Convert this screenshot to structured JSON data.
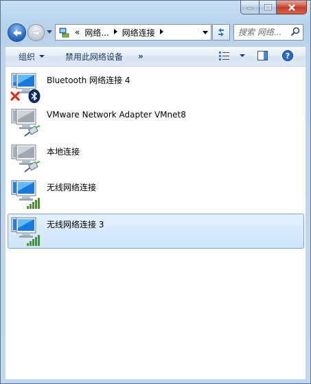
{
  "window": {
    "caption_buttons": [
      "minimize",
      "maximize",
      "close"
    ]
  },
  "nav": {
    "address_segments": [
      "«",
      "网络...",
      "网络连接"
    ],
    "search_placeholder": "搜索 网络..."
  },
  "toolbar": {
    "organize_label": "组织",
    "disable_label": "禁用此网络设备",
    "more_label": "»"
  },
  "connections": [
    {
      "name": "Bluetooth 网络连接 4",
      "icon": "computer-icon",
      "badge": "bluetooth-disconnected-icon",
      "selected": false
    },
    {
      "name": "VMware Network Adapter VMnet8",
      "icon": "computer-icon-gray",
      "badge": "ethernet-cable-icon",
      "selected": false
    },
    {
      "name": "本地连接",
      "icon": "computer-icon-gray",
      "badge": "ethernet-cable-icon",
      "selected": false
    },
    {
      "name": "无线网络连接",
      "icon": "computer-icon",
      "badge": "signal-bars-icon",
      "selected": false
    },
    {
      "name": "无线网络连接 3",
      "icon": "computer-icon",
      "badge": "signal-bars-icon",
      "selected": true
    }
  ],
  "colors": {
    "accent": "#1e395b",
    "selection_border": "#7da2ce",
    "selection_fill": "#cfe5fa",
    "signal_green": "#37a11a",
    "close_red": "#c33a25"
  }
}
